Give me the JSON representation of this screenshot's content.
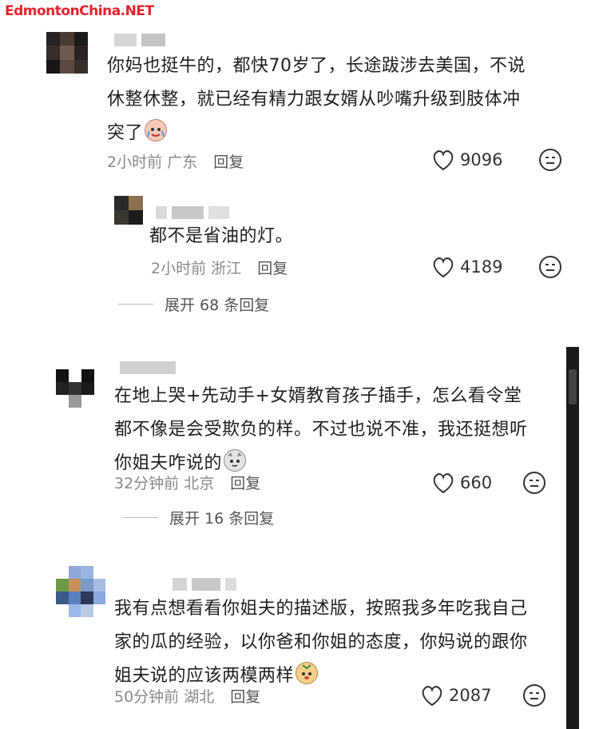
{
  "watermark": "EdmontonChina.NET",
  "comments": [
    {
      "text": "你妈也挺牛的，都快70岁了，长途跋涉去美国，不说休整休整，就已经有精力跟女婿从吵嘴升级到肢体冲突了",
      "line1": "你妈也挺牛的，都快70岁了，长途跋涉去美国，不说",
      "line2": "休整休整，就已经有精力跟女婿从吵嘴升级到肢体冲",
      "line3": "突了",
      "emoji": "crying-laugh-emoji",
      "time": "2小时前",
      "location": "广东",
      "reply_label": "回复",
      "likes": "9096"
    },
    {
      "text": "都不是省油的灯。",
      "time": "2小时前",
      "location": "浙江",
      "reply_label": "回复",
      "likes": "4189",
      "expand_label": "展开 68 条回复"
    },
    {
      "line1": "在地上哭+先动手+女婿教育孩子插手，怎么看令堂",
      "line2": "都不像是会受欺负的样。不过也说不准，我还挺想听",
      "line3": "你姐夫咋说的",
      "emoji": "cat-emoji",
      "time": "32分钟前",
      "location": "北京",
      "reply_label": "回复",
      "likes": "660",
      "expand_label": "展开 16 条回复"
    },
    {
      "line1": "我有点想看看你姐夫的描述版，按照我多年吃我自己",
      "line2": "家的瓜的经验，以你爸和你姐的态度，你妈说的跟你",
      "line3": "姐夫说的应该两模两样",
      "emoji": "dog-emoji",
      "time": "50分钟前",
      "location": "湖北",
      "reply_label": "回复",
      "likes": "2087"
    }
  ],
  "icons": {
    "like": "heart-outline-icon",
    "react": "neutral-face-icon"
  }
}
